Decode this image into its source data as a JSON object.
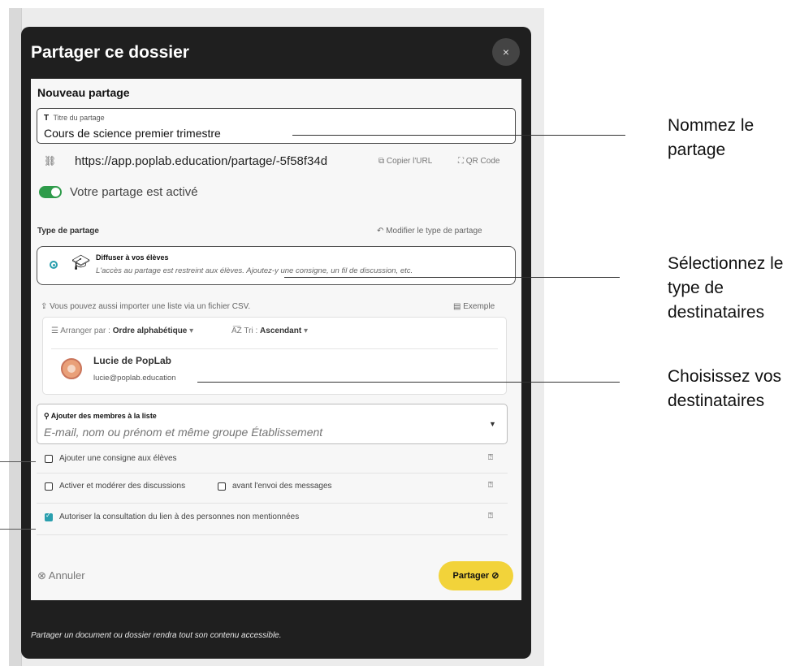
{
  "modal": {
    "title": "Partager ce dossier",
    "close_icon": "×",
    "footer_note": "Partager un document ou dossier rendra tout son contenu accessible."
  },
  "panel": {
    "heading": "Nouveau partage",
    "title_field": {
      "icon": "T",
      "label": "Titre du partage",
      "value": "Cours de science premier trimestre"
    },
    "url": {
      "icon": "⛓",
      "value": "https://app.poplab.education/partage/-5f58f34d",
      "copy_label": "Copier l'URL",
      "qr_label": "QR Code"
    },
    "toggle_label": "Votre partage est activé",
    "share_type": {
      "label": "Type de partage",
      "modify_label": "Modifier le type de partage",
      "option_title": "Diffuser à vos élèves",
      "option_desc": "L'accès au partage est restreint aux élèves. Ajoutez-y une consigne, un fil de discussion, etc."
    },
    "csv": {
      "text": "Vous pouvez aussi importer une liste via un fichier CSV.",
      "example_label": "Exemple"
    },
    "members": {
      "arrange_label": "Arranger par :",
      "arrange_value": "Ordre alphabétique",
      "sort_label": "Tri :",
      "sort_value": "Ascendant",
      "list": [
        {
          "name": "Lucie de PopLab",
          "email": "lucie@poplab.education"
        }
      ]
    },
    "add_members": {
      "label": "Ajouter des membres à la liste",
      "placeholder": "E-mail, nom ou prénom et même groupe Établissement"
    },
    "options": {
      "instruction": "Ajouter une consigne aux élèves",
      "discussions": "Activer et modérer des discussions",
      "before_send": "avant l'envoi des messages",
      "authorize": "Autoriser la consultation du lien à des personnes non mentionnées"
    },
    "cancel_label": "Annuler",
    "share_label": "Partager"
  },
  "callouts": {
    "name": "Nommez le partage",
    "type": "Sélectionnez le type de destinataires",
    "recipients": "Choisissez vos destinataires"
  }
}
